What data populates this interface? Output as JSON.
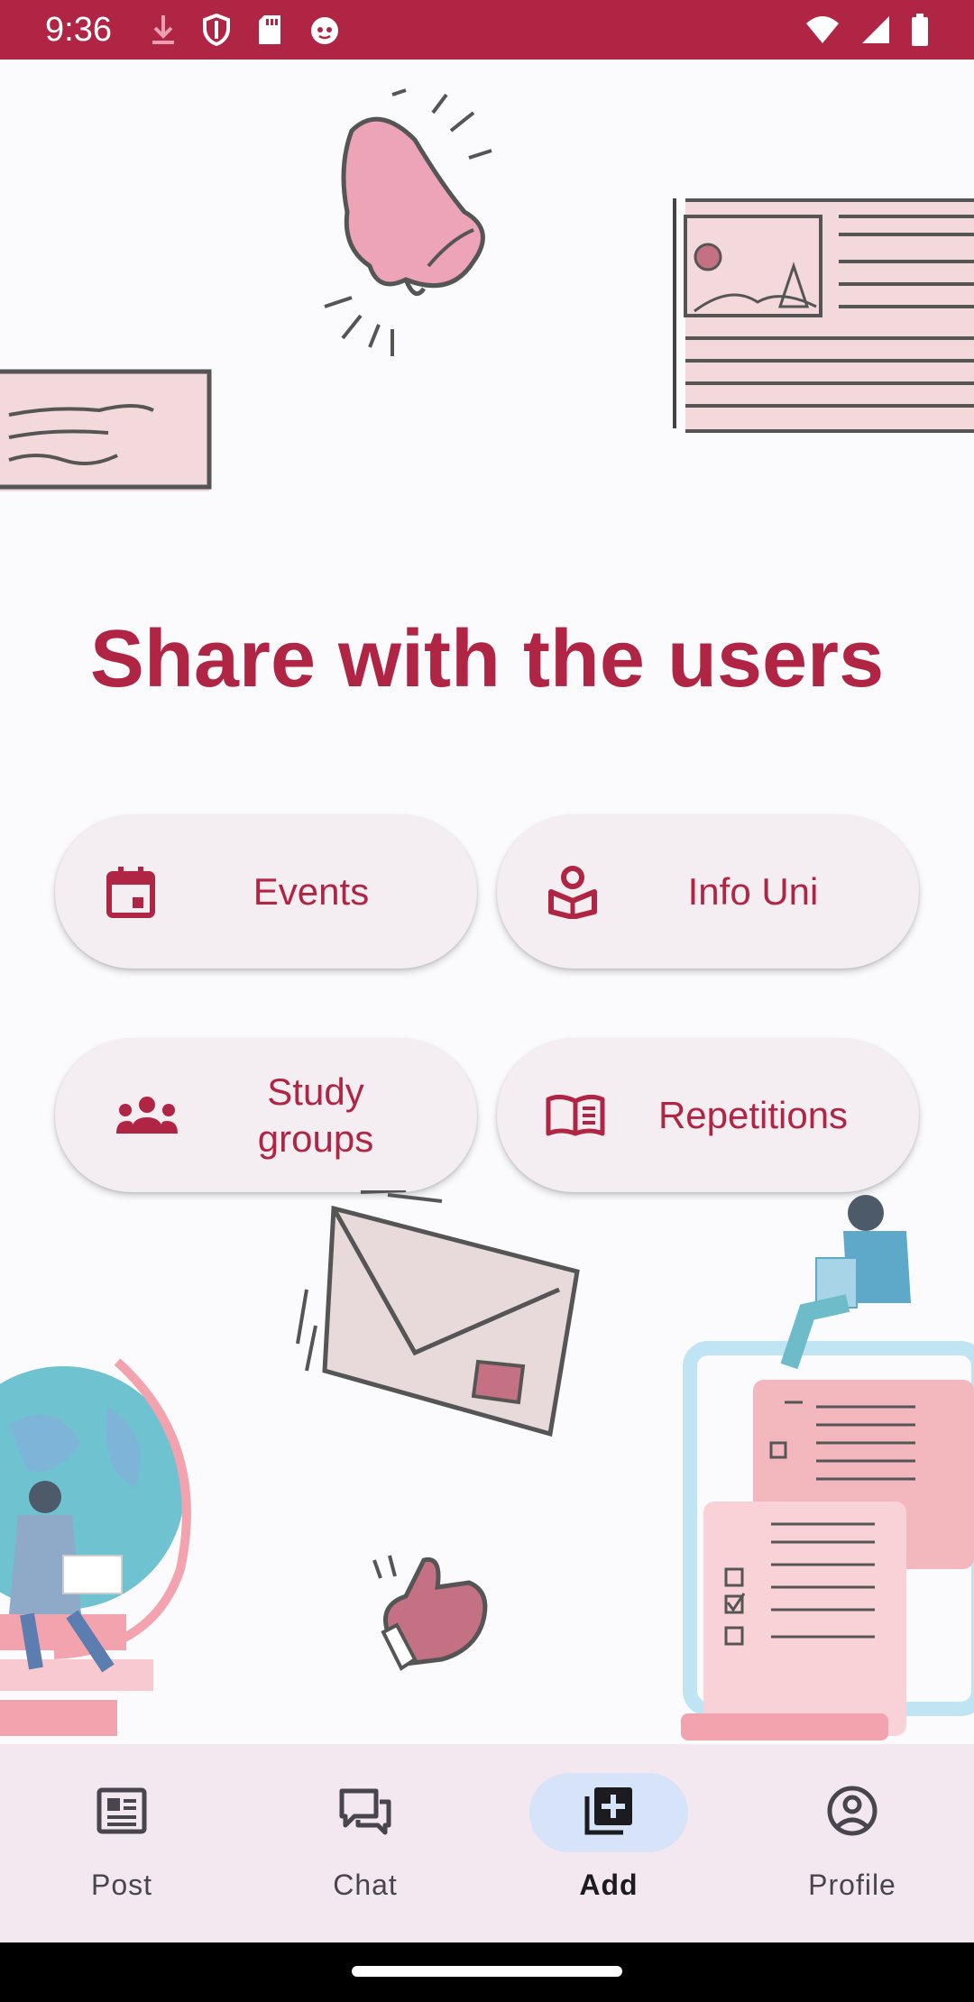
{
  "status_bar": {
    "time": "9:36",
    "left_icons": [
      "download-icon",
      "shield-icon",
      "sd-card-icon",
      "cat-icon"
    ],
    "right_icons": [
      "wifi-icon",
      "signal-icon",
      "battery-icon"
    ],
    "background": "#b02544"
  },
  "main": {
    "title": "Share with the users",
    "actions": [
      {
        "label": "Events",
        "icon": "calendar-icon"
      },
      {
        "label": "Info Uni",
        "icon": "reading-person-icon"
      },
      {
        "label": "Study groups",
        "icon": "groups-icon"
      },
      {
        "label": "Repetitions",
        "icon": "open-book-icon"
      }
    ]
  },
  "bottom_nav": {
    "items": [
      {
        "label": "Post",
        "icon": "newspaper-icon",
        "active": false
      },
      {
        "label": "Chat",
        "icon": "chat-bubbles-icon",
        "active": false
      },
      {
        "label": "Add",
        "icon": "add-library-icon",
        "active": true
      },
      {
        "label": "Profile",
        "icon": "account-circle-icon",
        "active": false
      }
    ]
  },
  "colors": {
    "accent": "#b02544",
    "button_bg": "#f4eef3",
    "nav_bg": "#f3e8ef",
    "nav_active_pill": "#d6e3f8",
    "page_bg": "#fbfbfe"
  }
}
